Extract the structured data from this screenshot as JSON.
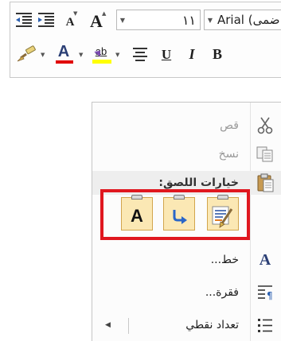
{
  "toolbar": {
    "font_size_value": "١١",
    "font_name_value": "Arial (ضمى",
    "grow_font_glyph": "A",
    "shrink_font_glyph": "A",
    "font_color_glyph": "A",
    "highlight_glyph": "ab",
    "underline_glyph": "U",
    "italic_glyph": "I",
    "bold_glyph": "B",
    "colors": {
      "font_color": "#e00000",
      "highlight": "#ffff00"
    }
  },
  "menu": {
    "cut_label": "قص",
    "copy_label": "نسخ",
    "paste_options_label": "خيارات اللصق:",
    "paste_option_glyph": "A",
    "font_label": "خط...",
    "paragraph_label": "فقرة...",
    "bullets_label": "تعداد نقطي",
    "font_icon_glyph": "A"
  },
  "colors": {
    "highlight_frame": "#e0171f",
    "paste_option_bg": "#fbe8b4"
  }
}
